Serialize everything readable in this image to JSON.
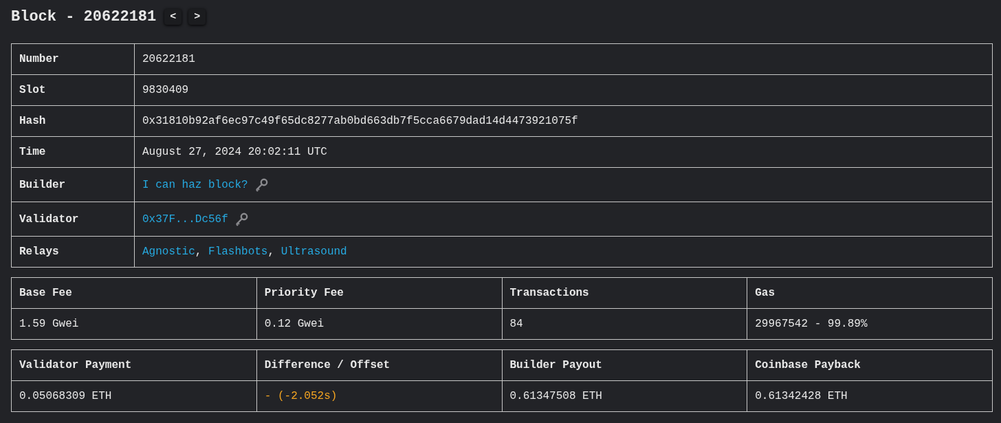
{
  "header": {
    "title": "Block - 20622181",
    "prev": "<",
    "next": ">"
  },
  "details": [
    {
      "label": "Number",
      "kind": "text",
      "value": "20622181"
    },
    {
      "label": "Slot",
      "kind": "text",
      "value": "9830409"
    },
    {
      "label": "Hash",
      "kind": "text",
      "value": "0x31810b92af6ec97c49f65dc8277ab0bd663db7f5cca6679dad14d4473921075f"
    },
    {
      "label": "Time",
      "kind": "text",
      "value": "August 27, 2024 20:02:11 UTC"
    },
    {
      "label": "Builder",
      "kind": "link_key",
      "value": "I can haz block?"
    },
    {
      "label": "Validator",
      "kind": "link_key",
      "value": "0x37F...Dc56f"
    },
    {
      "label": "Relays",
      "kind": "links",
      "links": [
        "Agnostic",
        "Flashbots",
        "Ultrasound"
      ],
      "separator": ","
    }
  ],
  "stats": [
    {
      "cells": [
        {
          "label": "Base Fee",
          "value": "1.59 Gwei",
          "kind": "normal"
        },
        {
          "label": "Priority Fee",
          "value": "0.12 Gwei",
          "kind": "normal"
        },
        {
          "label": "Transactions",
          "value": "84",
          "kind": "normal"
        },
        {
          "label": "Gas",
          "value": "29967542 - 99.89%",
          "kind": "normal"
        }
      ]
    },
    {
      "cells": [
        {
          "label": "Validator Payment",
          "value": "0.05068309 ETH",
          "kind": "normal"
        },
        {
          "label": "Difference / Offset",
          "value": "- (-2.052s)",
          "kind": "warning"
        },
        {
          "label": "Builder Payout",
          "value": "0.61347508 ETH",
          "kind": "normal"
        },
        {
          "label": "Coinbase Payback",
          "value": "0.61342428 ETH",
          "kind": "normal"
        }
      ]
    }
  ]
}
